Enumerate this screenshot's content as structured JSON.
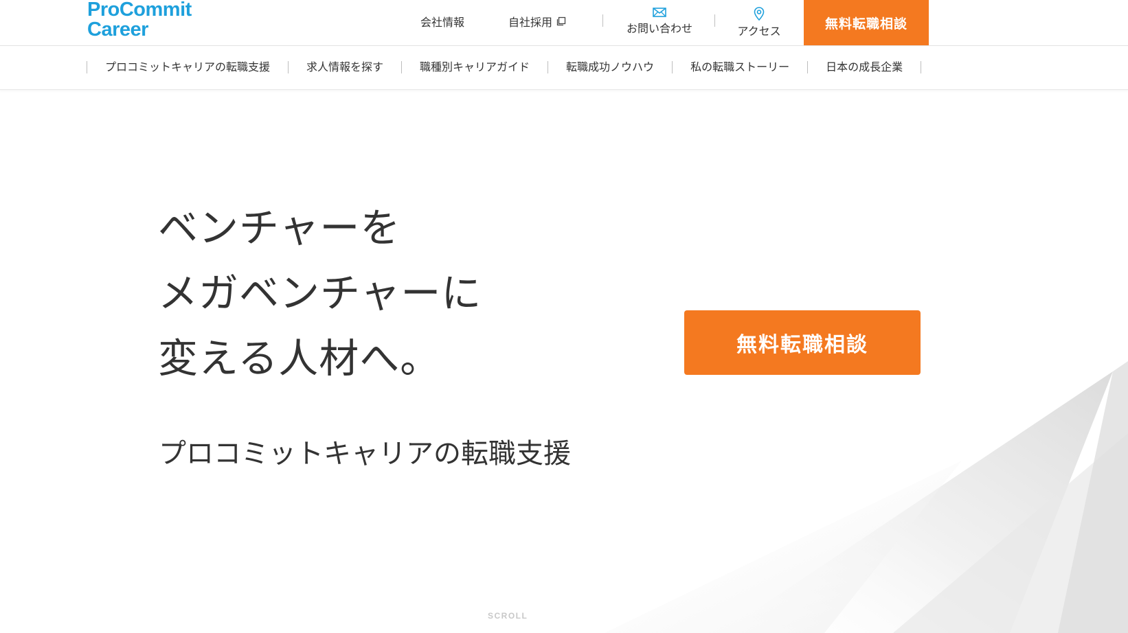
{
  "header": {
    "logo_line1": "ProCommit",
    "logo_line2": "Career",
    "company_info": "会社情報",
    "recruit": "自社採用",
    "contact": "お問い合わせ",
    "access": "アクセス",
    "cta": "無料転職相談"
  },
  "nav": {
    "items": [
      "プロコミットキャリアの転職支援",
      "求人情報を探す",
      "職種別キャリアガイド",
      "転職成功ノウハウ",
      "私の転職ストーリー",
      "日本の成長企業"
    ]
  },
  "hero": {
    "headline": [
      "ベンチャーを",
      "メガベンチャーに",
      "変える人材へ。"
    ],
    "subhead": "プロコミットキャリアの転職支援",
    "cta": "無料転職相談",
    "scroll": "SCROLL"
  },
  "colors": {
    "brand_blue": "#1ea0dc",
    "accent_orange": "#f47920"
  },
  "icons": {
    "recruit": "external-window-icon",
    "contact": "mail-icon",
    "access": "map-pin-icon"
  }
}
